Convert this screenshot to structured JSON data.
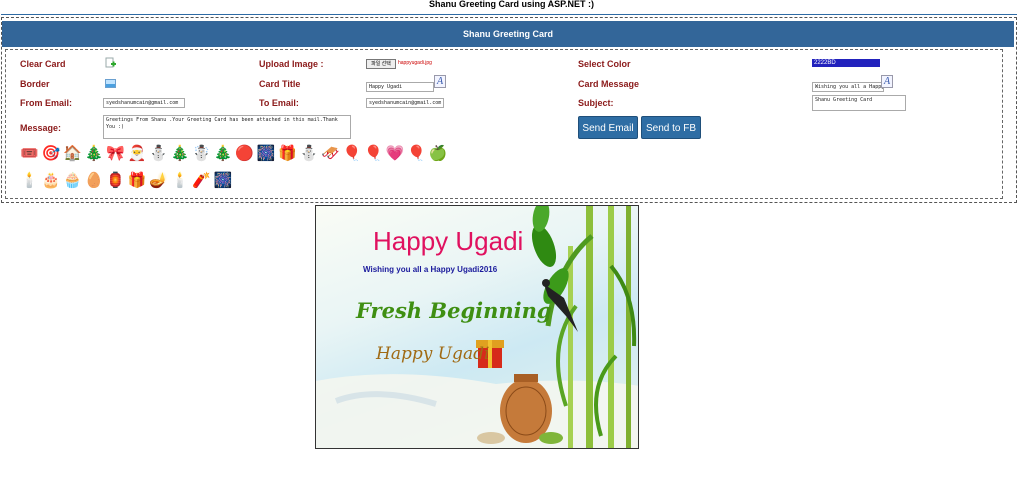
{
  "page": {
    "title": "Shanu Greeting Card using ASP.NET :)"
  },
  "header": {
    "title": "Shanu Greeting Card"
  },
  "form": {
    "clear_card_label": "Clear Card",
    "border_label": "Border",
    "from_email_label": "From Email:",
    "from_email_value": "syedshanumcain@gmail.com",
    "message_label": "Message:",
    "message_value": "Greetings From Shanu .Your Greeting Card has been attached in this mail.Thank You :)",
    "upload_label": "Upload Image :",
    "file_button": "파일 선택",
    "file_name": "happyugadi.jpg",
    "card_title_label": "Card Title",
    "card_title_value": "Happy Ugadi",
    "to_email_label": "To Email:",
    "to_email_value": "syedshanumcain@gmail.com",
    "select_color_label": "Select Color",
    "color_value": "2222BD",
    "card_message_label": "Card Message",
    "card_message_value": "Wishing you all a Happy Ugadi2016",
    "subject_label": "Subject:",
    "subject_value": "Shanu Greeting Card",
    "send_email_button": "Send Email",
    "send_fb_button": "Send to FB",
    "font_glyph": "A"
  },
  "stickers": {
    "row1": [
      "🎟️",
      "🎯",
      "🏠",
      "🎄",
      "🎀",
      "🎅",
      "⛄",
      "🎄",
      "☃️",
      "🎄",
      "🔴",
      "🎆",
      "🎁",
      "⛄",
      "🛷",
      "🎈",
      "🎈",
      "💗",
      "🎈",
      "🍏"
    ],
    "row2": [
      "🕯️",
      "🎂",
      "🧁",
      "🥚",
      "🏮",
      "🎁",
      "🪔",
      "🕯️",
      "🧨",
      "🎆"
    ]
  },
  "card": {
    "title": "Happy Ugadi",
    "message": "Wishing you all a Happy Ugadi2016",
    "image_text_1": "Fresh Beginning",
    "image_text_2": "Happy Ugadi",
    "title_color": "#e0115f",
    "message_color": "#2222bd"
  }
}
